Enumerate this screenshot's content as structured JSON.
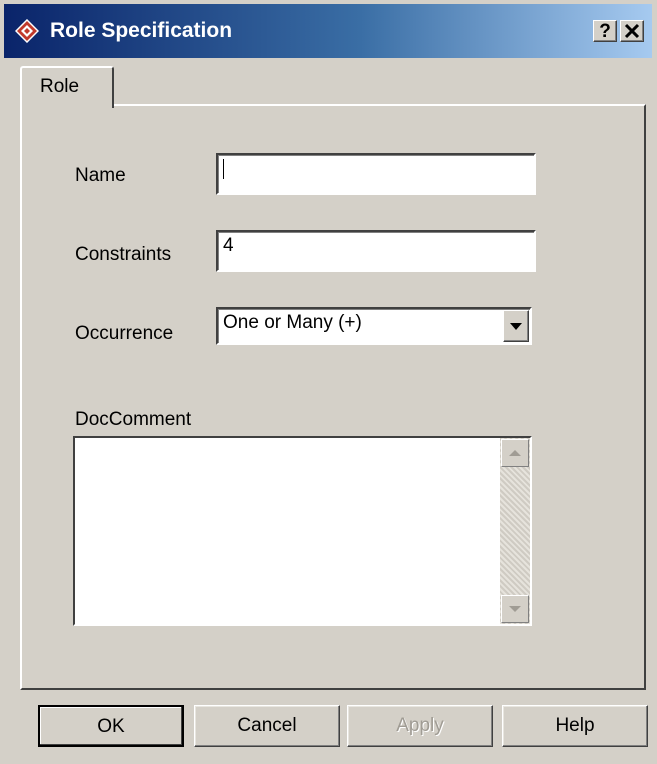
{
  "window": {
    "title": "Role Specification",
    "help_label": "?",
    "close_label": "✕"
  },
  "tabs": [
    {
      "label": "Role",
      "selected": true
    }
  ],
  "form": {
    "name": {
      "label": "Name",
      "value": ""
    },
    "constraints": {
      "label": "Constraints",
      "value": "4"
    },
    "occurrence": {
      "label": "Occurrence",
      "value": "One or Many (+)"
    },
    "doc_comment": {
      "label": "DocComment",
      "value": ""
    }
  },
  "buttons": {
    "ok": "OK",
    "cancel": "Cancel",
    "apply": "Apply",
    "help": "Help"
  },
  "colors": {
    "face": "#d4d0c8",
    "title_start": "#0a246a",
    "title_end": "#a6caf0",
    "icon_red": "#c0392b"
  }
}
